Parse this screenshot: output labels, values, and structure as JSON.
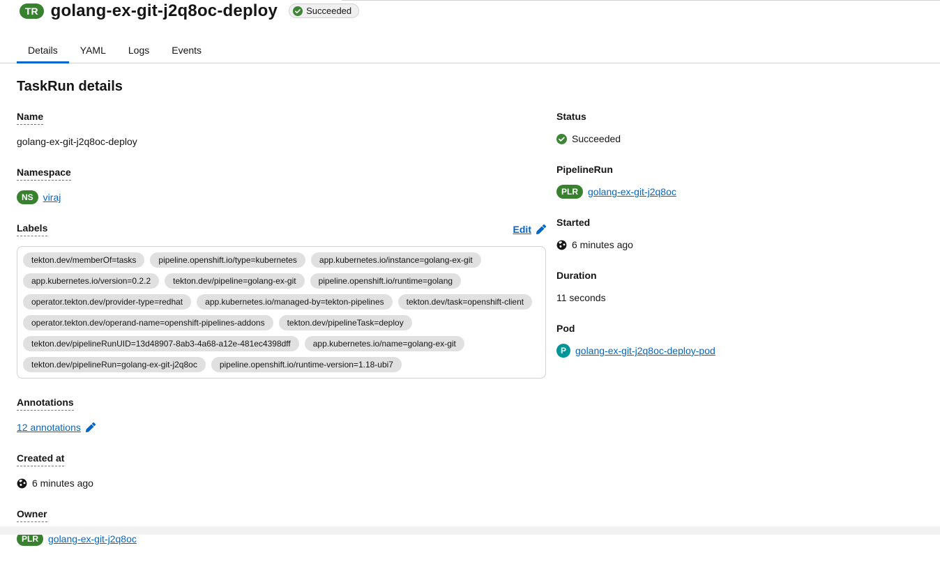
{
  "page": {
    "resource_badge": "TR",
    "title": "golang-ex-git-j2q8oc-deploy",
    "header_status": "Succeeded"
  },
  "tabs": [
    {
      "label": "Details",
      "active": true
    },
    {
      "label": "YAML",
      "active": false
    },
    {
      "label": "Logs",
      "active": false
    },
    {
      "label": "Events",
      "active": false
    }
  ],
  "section_title": "TaskRun details",
  "details": {
    "name": {
      "label": "Name",
      "value": "golang-ex-git-j2q8oc-deploy"
    },
    "namespace": {
      "label": "Namespace",
      "badge": "NS",
      "value": "viraj"
    },
    "labels": {
      "label": "Labels",
      "edit_label": "Edit",
      "chips": [
        "tekton.dev/memberOf=tasks",
        "pipeline.openshift.io/type=kubernetes",
        "app.kubernetes.io/instance=golang-ex-git",
        "app.kubernetes.io/version=0.2.2",
        "tekton.dev/pipeline=golang-ex-git",
        "pipeline.openshift.io/runtime=golang",
        "operator.tekton.dev/provider-type=redhat",
        "app.kubernetes.io/managed-by=tekton-pipelines",
        "tekton.dev/task=openshift-client",
        "operator.tekton.dev/operand-name=openshift-pipelines-addons",
        "tekton.dev/pipelineTask=deploy",
        "tekton.dev/pipelineRunUID=13d48907-8ab3-4a68-a12e-481ec4398dff",
        "app.kubernetes.io/name=golang-ex-git",
        "tekton.dev/pipelineRun=golang-ex-git-j2q8oc",
        "pipeline.openshift.io/runtime-version=1.18-ubi7"
      ]
    },
    "annotations": {
      "label": "Annotations",
      "value": "12 annotations"
    },
    "created_at": {
      "label": "Created at",
      "value": "6 minutes ago"
    },
    "owner": {
      "label": "Owner",
      "badge": "PLR",
      "value": "golang-ex-git-j2q8oc"
    },
    "status": {
      "label": "Status",
      "value": "Succeeded"
    },
    "pipeline_run": {
      "label": "PipelineRun",
      "badge": "PLR",
      "value": "golang-ex-git-j2q8oc"
    },
    "started": {
      "label": "Started",
      "value": "6 minutes ago"
    },
    "duration": {
      "label": "Duration",
      "value": "11 seconds"
    },
    "pod": {
      "label": "Pod",
      "badge": "P",
      "value": "golang-ex-git-j2q8oc-deploy-pod"
    }
  },
  "colors": {
    "accent_link": "#0066cc",
    "active_tab": "#0066cc",
    "resource_badge_green": "#38812f",
    "pod_badge_teal": "#009596",
    "success_green": "#3e8635",
    "chip_gray": "#e0e0e0"
  }
}
